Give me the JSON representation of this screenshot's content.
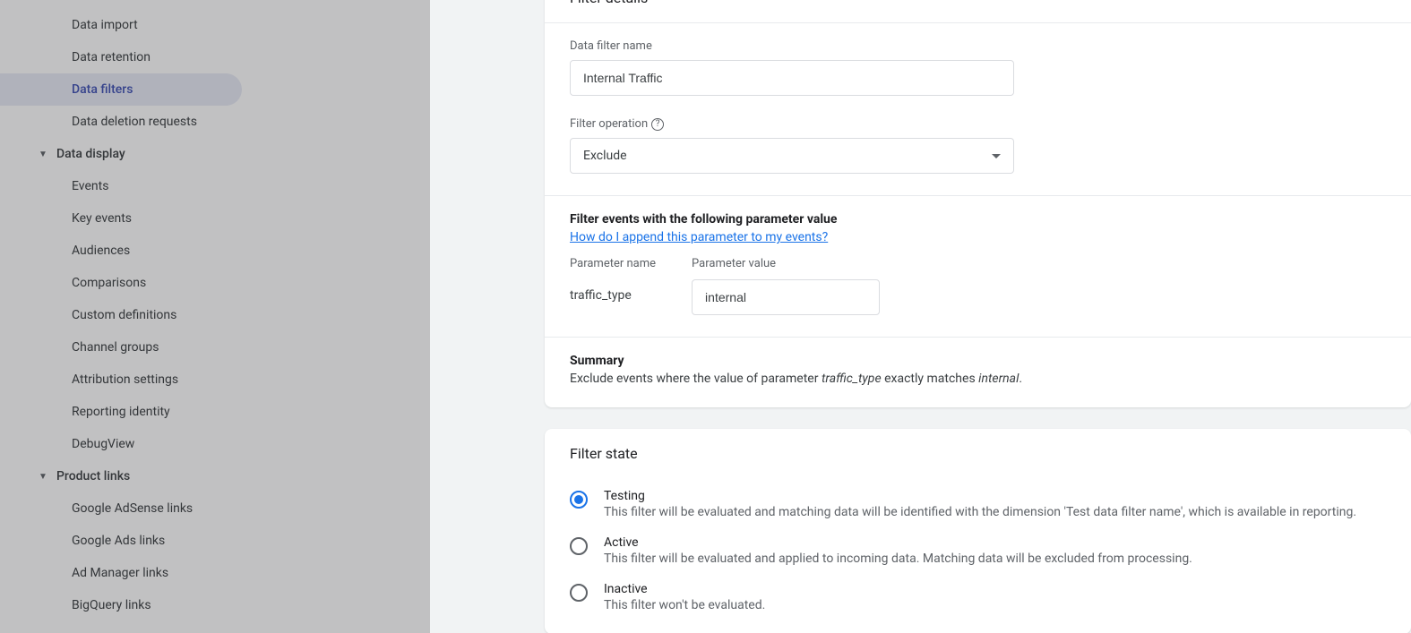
{
  "sidebar": {
    "items_top": [
      "Data import",
      "Data retention",
      "Data filters",
      "Data deletion requests"
    ],
    "active_index": 2,
    "group_data_display": "Data display",
    "items_data_display": [
      "Events",
      "Key events",
      "Audiences",
      "Comparisons",
      "Custom definitions",
      "Channel groups",
      "Attribution settings",
      "Reporting identity",
      "DebugView"
    ],
    "group_product_links": "Product links",
    "items_product_links": [
      "Google AdSense links",
      "Google Ads links",
      "Ad Manager links",
      "BigQuery links"
    ]
  },
  "details_card": {
    "title": "Filter details",
    "name_label": "Data filter name",
    "name_value": "Internal Traffic",
    "operation_label": "Filter operation",
    "operation_value": "Exclude",
    "filter_events_heading": "Filter events with the following parameter value",
    "help_link": "How do I append this parameter to my events?",
    "param_name_label": "Parameter name",
    "param_name_value": "traffic_type",
    "param_value_label": "Parameter value",
    "param_value_value": "internal",
    "summary_heading": "Summary",
    "summary_prefix": "Exclude events where the value of parameter ",
    "summary_param": "traffic_type",
    "summary_middle": " exactly matches ",
    "summary_value": "internal",
    "summary_suffix": "."
  },
  "state_card": {
    "title": "Filter state",
    "options": [
      {
        "title": "Testing",
        "desc": "This filter will be evaluated and matching data will be identified with the dimension 'Test data filter name', which is available in reporting.",
        "selected": true
      },
      {
        "title": "Active",
        "desc": "This filter will be evaluated and applied to incoming data. Matching data will be excluded from processing.",
        "selected": false
      },
      {
        "title": "Inactive",
        "desc": "This filter won't be evaluated.",
        "selected": false
      }
    ]
  }
}
